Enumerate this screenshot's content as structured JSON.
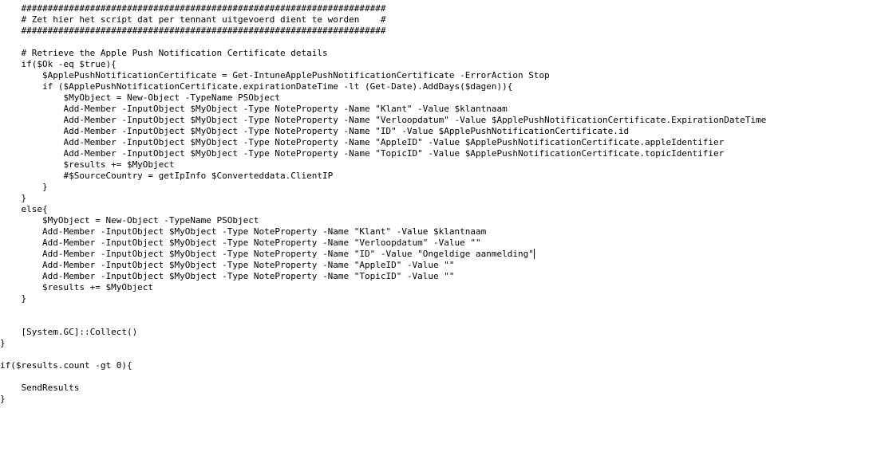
{
  "code": {
    "lines": [
      "    #####################################################################",
      "    # Zet hier het script dat per tennant uitgevoerd dient te worden    #",
      "    #####################################################################",
      "",
      "    # Retrieve the Apple Push Notification Certificate details",
      "    if($Ok -eq $true){",
      "        $ApplePushNotificationCertificate = Get-IntuneApplePushNotificationCertificate -ErrorAction Stop",
      "        if ($ApplePushNotificationCertificate.expirationDateTime -lt (Get-Date).AddDays($dagen)){",
      "            $MyObject = New-Object -TypeName PSObject",
      "            Add-Member -InputObject $MyObject -Type NoteProperty -Name \"Klant\" -Value $klantnaam",
      "            Add-Member -InputObject $MyObject -Type NoteProperty -Name \"Verloopdatum\" -Value $ApplePushNotificationCertificate.ExpirationDateTime",
      "            Add-Member -InputObject $MyObject -Type NoteProperty -Name \"ID\" -Value $ApplePushNotificationCertificate.id",
      "            Add-Member -InputObject $MyObject -Type NoteProperty -Name \"AppleID\" -Value $ApplePushNotificationCertificate.appleIdentifier",
      "            Add-Member -InputObject $MyObject -Type NoteProperty -Name \"TopicID\" -Value $ApplePushNotificationCertificate.topicIdentifier",
      "            $results += $MyObject",
      "            #$SourceCountry = getIpInfo $Converteddata.ClientIP",
      "        }",
      "    }",
      "    else{",
      "        $MyObject = New-Object -TypeName PSObject",
      "        Add-Member -InputObject $MyObject -Type NoteProperty -Name \"Klant\" -Value $klantnaam",
      "        Add-Member -InputObject $MyObject -Type NoteProperty -Name \"Verloopdatum\" -Value \"\"",
      "        Add-Member -InputObject $MyObject -Type NoteProperty -Name \"ID\" -Value \"Ongeldige aanmelding\"",
      "        Add-Member -InputObject $MyObject -Type NoteProperty -Name \"AppleID\" -Value \"\"",
      "        Add-Member -InputObject $MyObject -Type NoteProperty -Name \"TopicID\" -Value \"\"",
      "        $results += $MyObject",
      "    }",
      "",
      "",
      "    [System.GC]::Collect()",
      "}",
      "",
      "if($results.count -gt 0){",
      "",
      "    SendResults",
      "}"
    ],
    "cursor_line_index": 22
  }
}
